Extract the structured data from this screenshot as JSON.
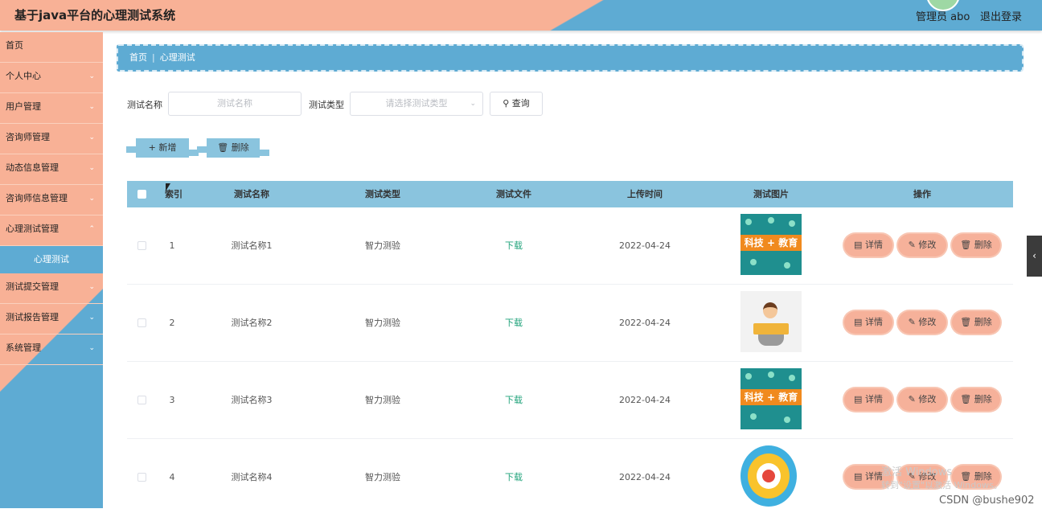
{
  "header": {
    "title": "基于java平台的心理测试系统",
    "user": "管理员 abo",
    "logout": "退出登录"
  },
  "sidebar": {
    "items": [
      {
        "label": "首页",
        "expandable": false
      },
      {
        "label": "个人中心",
        "expandable": true
      },
      {
        "label": "用户管理",
        "expandable": true
      },
      {
        "label": "咨询师管理",
        "expandable": true
      },
      {
        "label": "动态信息管理",
        "expandable": true
      },
      {
        "label": "咨询师信息管理",
        "expandable": true
      },
      {
        "label": "心理测试管理",
        "expandable": true
      }
    ],
    "active_sub": "心理测试",
    "items_after": [
      {
        "label": "测试提交管理",
        "expandable": true
      },
      {
        "label": "测试报告管理",
        "expandable": true
      },
      {
        "label": "系统管理",
        "expandable": true
      }
    ]
  },
  "breadcrumb": {
    "home": "首页",
    "current": "心理测试"
  },
  "search": {
    "name_label": "测试名称",
    "name_placeholder": "测试名称",
    "type_label": "测试类型",
    "type_placeholder": "请选择测试类型",
    "query_label": "查询"
  },
  "actions": {
    "add_label": "新增",
    "delete_label": "删除"
  },
  "table": {
    "columns": [
      "索引",
      "测试名称",
      "测试类型",
      "测试文件",
      "上传时间",
      "测试图片",
      "操作"
    ],
    "rows": [
      {
        "index": "1",
        "name": "测试名称1",
        "type": "智力测验",
        "file": "下载",
        "time": "2022-04-24",
        "image": "tech"
      },
      {
        "index": "2",
        "name": "测试名称2",
        "type": "智力测验",
        "file": "下载",
        "time": "2022-04-24",
        "image": "kid"
      },
      {
        "index": "3",
        "name": "测试名称3",
        "type": "智力测验",
        "file": "下载",
        "time": "2022-04-24",
        "image": "tech"
      },
      {
        "index": "4",
        "name": "测试名称4",
        "type": "智力测验",
        "file": "下载",
        "time": "2022-04-24",
        "image": "ring"
      }
    ],
    "row_actions": {
      "detail": "详情",
      "edit": "修改",
      "delete": "删除"
    },
    "image_caption": "科技 + 教育"
  },
  "watermark": {
    "line1": "激活 Windows",
    "line2": "转到\"设置\"以激活 Windows。"
  },
  "footer_credit": "CSDN @bushe902",
  "colors": {
    "peach": "#f8b196",
    "blue": "#5eabd3",
    "header_blue": "#8ac4de",
    "download_green": "#21a37b"
  }
}
